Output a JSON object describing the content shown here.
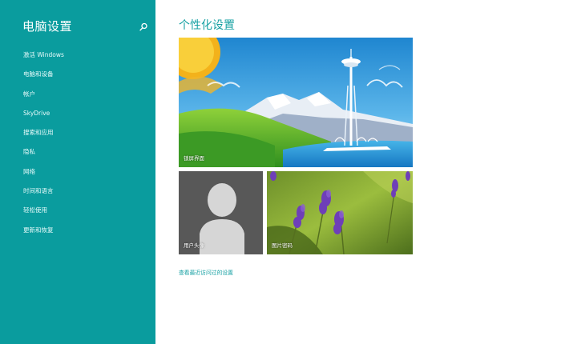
{
  "sidebar": {
    "title": "电脑设置",
    "search_icon": "search-icon",
    "items": [
      {
        "label": "激活 Windows"
      },
      {
        "label": "电脑和设备"
      },
      {
        "label": "帐户"
      },
      {
        "label": "SkyDrive"
      },
      {
        "label": "搜索和应用"
      },
      {
        "label": "隐私"
      },
      {
        "label": "网络"
      },
      {
        "label": "时间和语言"
      },
      {
        "label": "轻松使用"
      },
      {
        "label": "更新和恢复"
      }
    ]
  },
  "main": {
    "title": "个性化设置",
    "tiles": {
      "lock_screen": "锁屏界面",
      "account_picture": "用户头像",
      "start_background": "图片密码"
    },
    "recent_link": "查看最近访问过的设置"
  },
  "colors": {
    "sidebar_bg": "#0a9c9e",
    "accent": "#17a1a3",
    "page_bg": "#ffffff"
  }
}
